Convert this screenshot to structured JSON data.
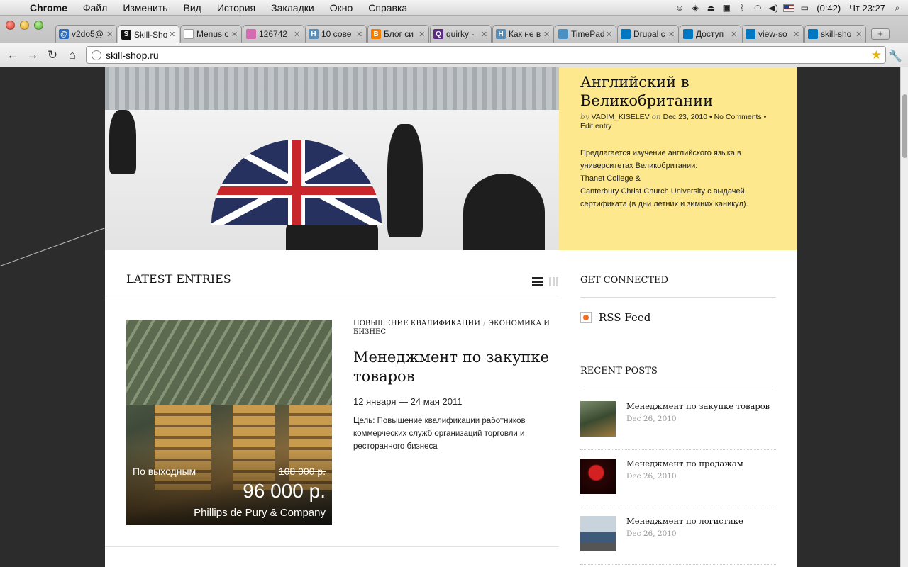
{
  "menubar": {
    "app": "Chrome",
    "items": [
      "Файл",
      "Изменить",
      "Вид",
      "История",
      "Закладки",
      "Окно",
      "Справка"
    ],
    "battery": "(0:42)",
    "clock": "Чт 23:27"
  },
  "tabs": [
    {
      "label": "v2do5@",
      "fav": "@",
      "color": "#2a6ebd"
    },
    {
      "label": "Skill-Sho",
      "fav": "S",
      "color": "#111111"
    },
    {
      "label": "Menus c",
      "fav": "",
      "color": "#ffffff"
    },
    {
      "label": "126742",
      "fav": "",
      "color": "#d46bb0"
    },
    {
      "label": "10 сове",
      "fav": "H",
      "color": "#5a8db5"
    },
    {
      "label": "Блог си",
      "fav": "B",
      "color": "#f57d00"
    },
    {
      "label": "quirky -",
      "fav": "Q",
      "color": "#5b2c83"
    },
    {
      "label": "Как не в",
      "fav": "H",
      "color": "#5a8db5"
    },
    {
      "label": "TimePad",
      "fav": "",
      "color": "#4a90c2"
    },
    {
      "label": "Drupal c",
      "fav": "",
      "color": "#0077c0"
    },
    {
      "label": "Доступ",
      "fav": "",
      "color": "#0077c0"
    },
    {
      "label": "view-so",
      "fav": "",
      "color": "#0077c0"
    },
    {
      "label": "skill-sho",
      "fav": "",
      "color": "#0077c0"
    }
  ],
  "address": {
    "url": "skill-shop.ru"
  },
  "feature": {
    "title": "Английский в Великобритании",
    "by": "by",
    "author": "VADIM_KISELEV",
    "on": "on",
    "date": "Dec 23, 2010",
    "comments": "No Comments",
    "edit": "Edit entry",
    "excerpt_1": "Предлагается изучение английского языка в университетах Великобритании:",
    "excerpt_2": "Thanet College &",
    "excerpt_3": "Canterbury Christ Church University с выдачей сертификата (в дни летних и зимних каникул)."
  },
  "latest": {
    "heading": "LATEST ENTRIES",
    "entry": {
      "cat1": "Повышение квалификации",
      "cat2": "Экономика и бизнес",
      "title": "Менеджмент по закупке товаров",
      "dates": "12 января — 24 мая 2011",
      "goal": "Цель: Повышение квалификации работников коммерческих служб организаций торговли и ресторанного бизнеса",
      "weekend": "По выходным",
      "old_price": "108 000 р.",
      "price": "96 000 р.",
      "company": "Phillips de Pury & Company"
    }
  },
  "sidebar": {
    "connected_heading": "GET CONNECTED",
    "rss": "RSS Feed",
    "recent_heading": "RECENT POSTS",
    "posts": [
      {
        "title": "Менеджмент по закупке товаров",
        "date": "Dec 26, 2010"
      },
      {
        "title": "Менеджмент по продажам",
        "date": "Dec 26, 2010"
      },
      {
        "title": "Менеджмент по логистике",
        "date": "Dec 26, 2010"
      }
    ]
  }
}
